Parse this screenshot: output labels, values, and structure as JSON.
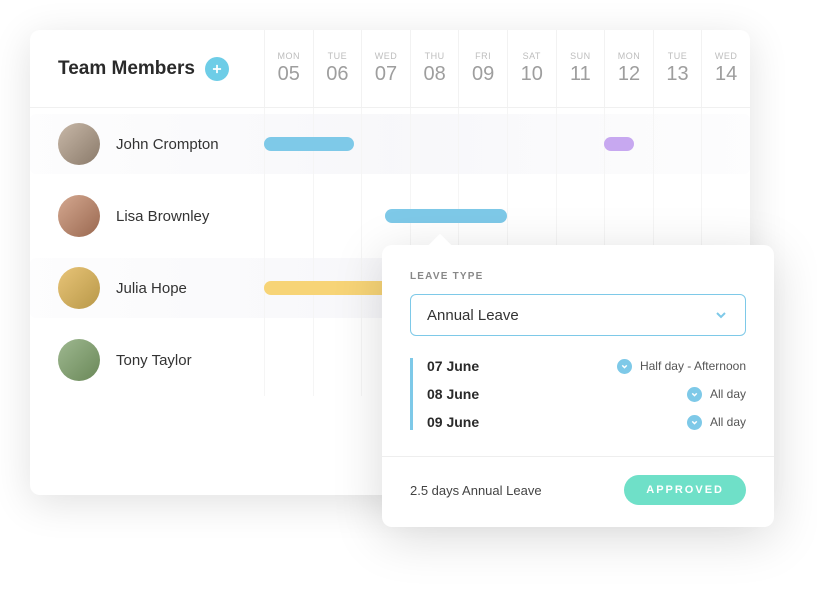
{
  "header": {
    "title": "Team Members"
  },
  "calendar": {
    "days": [
      {
        "dow": "MON",
        "num": "05"
      },
      {
        "dow": "TUE",
        "num": "06"
      },
      {
        "dow": "WED",
        "num": "07"
      },
      {
        "dow": "THU",
        "num": "08"
      },
      {
        "dow": "FRI",
        "num": "09"
      },
      {
        "dow": "SAT",
        "num": "10"
      },
      {
        "dow": "SUN",
        "num": "11"
      },
      {
        "dow": "MON",
        "num": "12"
      },
      {
        "dow": "TUE",
        "num": "13"
      },
      {
        "dow": "WED",
        "num": "14"
      }
    ]
  },
  "members": [
    {
      "name": "John Crompton"
    },
    {
      "name": "Lisa Brownley"
    },
    {
      "name": "Julia Hope"
    },
    {
      "name": "Tony Taylor"
    }
  ],
  "popover": {
    "label": "LEAVE TYPE",
    "leave_type": "Annual Leave",
    "entries": [
      {
        "date": "07 June",
        "desc": "Half day - Afternoon"
      },
      {
        "date": "08 June",
        "desc": "All day"
      },
      {
        "date": "09 June",
        "desc": "All day"
      }
    ],
    "summary": "2.5 days Annual Leave",
    "status": "APPROVED"
  }
}
